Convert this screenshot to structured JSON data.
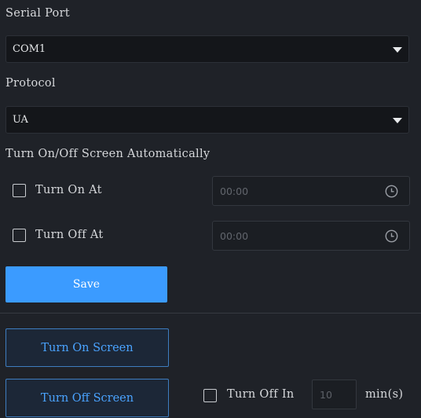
{
  "serial_port": {
    "label": "Serial Port",
    "selected": "COM1"
  },
  "protocol": {
    "label": "Protocol",
    "selected": "UA"
  },
  "auto_screen": {
    "heading": "Turn On/Off Screen Automatically",
    "turn_on": {
      "label": "Turn On At",
      "checked": false,
      "time_placeholder": "00:00"
    },
    "turn_off": {
      "label": "Turn Off At",
      "checked": false,
      "time_placeholder": "00:00"
    }
  },
  "save_label": "Save",
  "screen_actions": {
    "turn_on_label": "Turn On Screen",
    "turn_off_label": "Turn Off Screen"
  },
  "turn_off_in": {
    "label": "Turn Off In",
    "checked": false,
    "value_placeholder": "10",
    "unit": "min(s)"
  },
  "colors": {
    "background": "#1f2228",
    "accent": "#3b9bff",
    "outline_button_border": "#3e7dc0",
    "outline_button_text": "#4aa3ff"
  },
  "icons": {
    "dropdown": "chevron-down-icon",
    "time": "clock-icon",
    "checkbox": "checkbox-icon"
  }
}
